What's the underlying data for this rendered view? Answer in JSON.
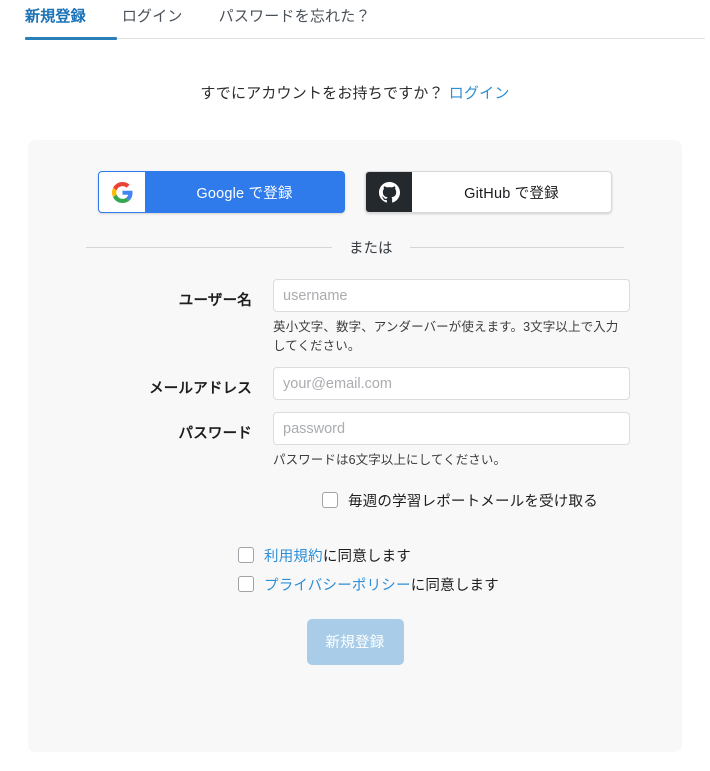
{
  "tabs": [
    {
      "label": "新規登録",
      "active": true
    },
    {
      "label": "ログイン",
      "active": false
    },
    {
      "label": "パスワードを忘れた？",
      "active": false
    }
  ],
  "subline": {
    "text": "すでにアカウントをお持ちですか？",
    "link_label": "ログイン"
  },
  "oauth": {
    "google": {
      "label": "Google で登録",
      "icon": "google-icon",
      "bg": "#2f7bec"
    },
    "github": {
      "label": "GitHub で登録",
      "icon": "github-icon",
      "bg": "#ffffff",
      "icon_bg": "#24292e"
    }
  },
  "divider": {
    "text": "または"
  },
  "form": {
    "username": {
      "label": "ユーザー名",
      "value": "",
      "placeholder": "username",
      "help": "英小文字、数字、アンダーバーが使えます。3文字以上で入力してください。"
    },
    "email": {
      "label": "メールアドレス",
      "value": "",
      "placeholder": "your@email.com",
      "help": ""
    },
    "password": {
      "label": "パスワード",
      "value": "",
      "placeholder": "password",
      "help": "パスワードは6文字以上にしてください。"
    }
  },
  "newsletter": {
    "label": "毎週の学習レポートメールを受け取る",
    "checked": false
  },
  "agreements": [
    {
      "link_label": "利用規約",
      "rest_label": "に同意します",
      "checked": false
    },
    {
      "link_label": "プライバシーポリシー",
      "rest_label": "に同意します",
      "checked": false
    }
  ],
  "submit": {
    "label": "新規登録",
    "disabled": true,
    "bg": "#a9cde9"
  },
  "colors": {
    "accent": "#2980b9",
    "link": "#2d8fd5",
    "card_bg": "#f8f8f9",
    "page_bg": "#ffffff"
  }
}
